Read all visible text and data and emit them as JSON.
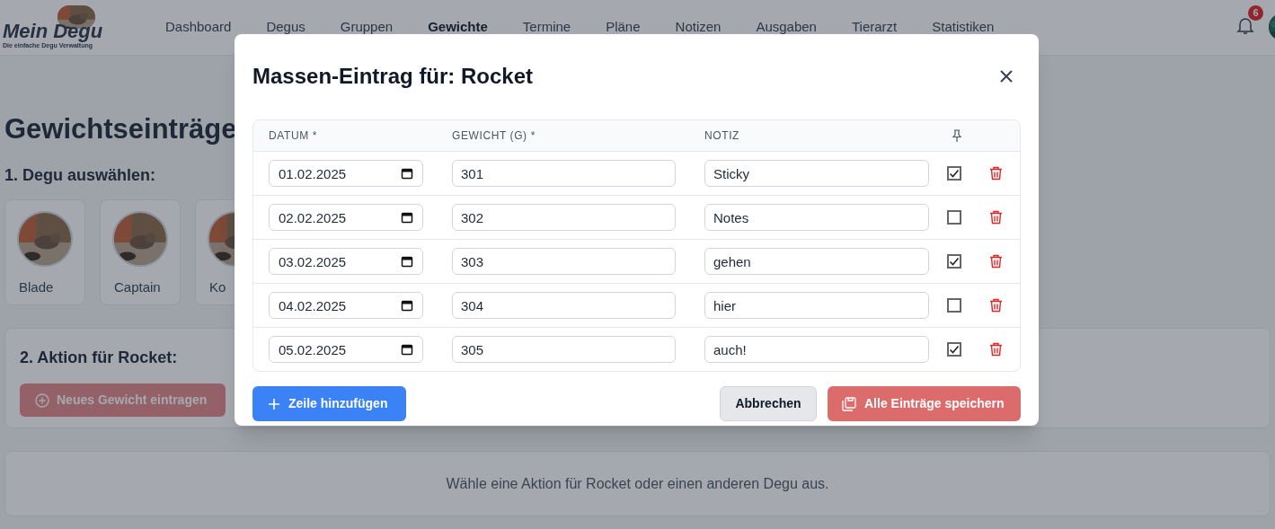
{
  "header": {
    "logo_title": "Mein Degu",
    "logo_subtitle": "Die einfache Degu Verwaltung",
    "nav": [
      {
        "label": "Dashboard",
        "selected": false
      },
      {
        "label": "Degus",
        "selected": false
      },
      {
        "label": "Gruppen",
        "selected": false
      },
      {
        "label": "Gewichte",
        "selected": true
      },
      {
        "label": "Termine",
        "selected": false
      },
      {
        "label": "Pläne",
        "selected": false
      },
      {
        "label": "Notizen",
        "selected": false
      },
      {
        "label": "Ausgaben",
        "selected": false
      },
      {
        "label": "Tierarzt",
        "selected": false
      },
      {
        "label": "Statistiken",
        "selected": false
      }
    ],
    "notification_count": "6"
  },
  "page": {
    "title": "Gewichtseinträge",
    "step1": "1. Degu auswählen:",
    "degus": [
      {
        "name": "Blade"
      },
      {
        "name": "Captain"
      },
      {
        "name": "Ko"
      }
    ],
    "step2": "2. Aktion für Rocket:",
    "action_button": "Neues Gewicht eintragen",
    "hint": "Wähle eine Aktion für Rocket oder einen anderen Degu aus."
  },
  "modal": {
    "title": "Massen-Eintrag für: Rocket",
    "columns": [
      "DATUM *",
      "GEWICHT (G) *",
      "NOTIZ"
    ],
    "rows": [
      {
        "date": "01.02.2025",
        "weight": "301",
        "note": "Sticky",
        "checked": true
      },
      {
        "date": "02.02.2025",
        "weight": "302",
        "note": "Notes",
        "checked": false
      },
      {
        "date": "03.02.2025",
        "weight": "303",
        "note": "gehen",
        "checked": true
      },
      {
        "date": "04.02.2025",
        "weight": "304",
        "note": "hier",
        "checked": false
      },
      {
        "date": "05.02.2025",
        "weight": "305",
        "note": "auch!",
        "checked": true
      }
    ],
    "add_button": "Zeile hinzufügen",
    "cancel_button": "Abbrechen",
    "save_button": "Alle Einträge speichern"
  }
}
